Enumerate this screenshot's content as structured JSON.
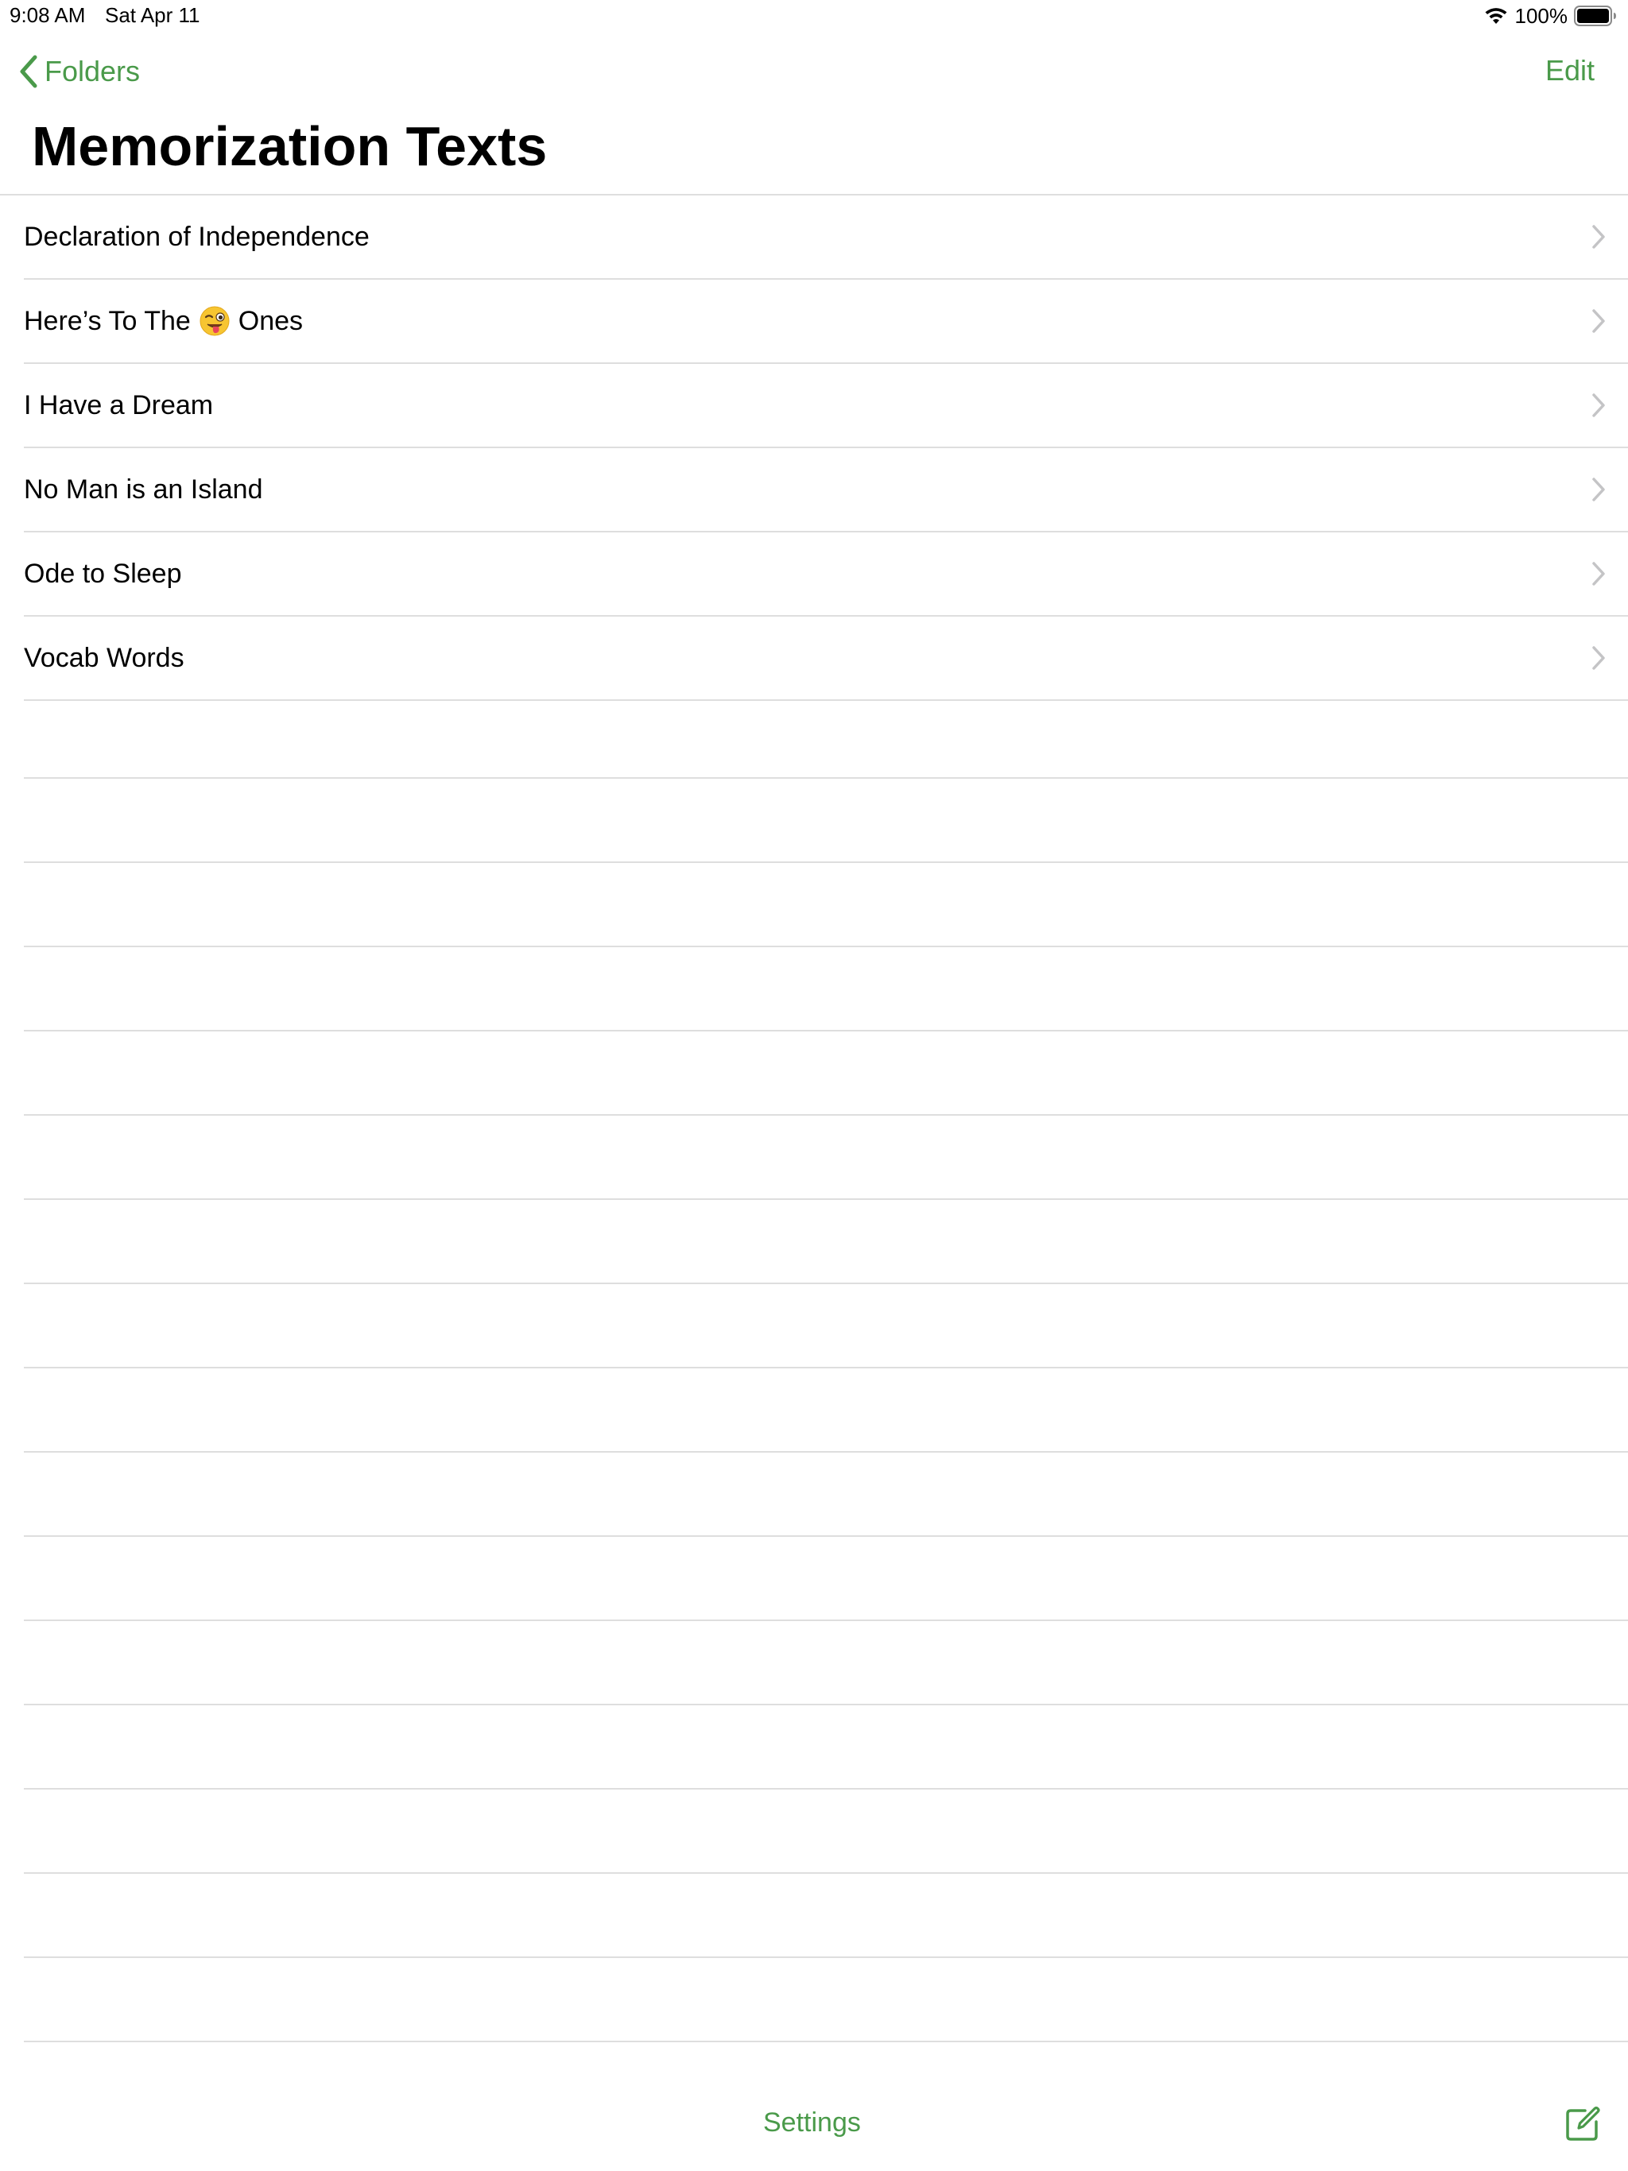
{
  "status_bar": {
    "time": "9:08 AM",
    "date": "Sat Apr 11",
    "battery": "100%"
  },
  "nav": {
    "back_label": "Folders",
    "edit_label": "Edit",
    "title": "Memorization Texts"
  },
  "texts": [
    {
      "label": "Declaration of Independence"
    },
    {
      "label_before": "Here’s To The",
      "emoji": "winking-face-with-tongue-icon",
      "label_after": "Ones"
    },
    {
      "label": "I Have a Dream"
    },
    {
      "label": "No Man is an Island"
    },
    {
      "label": "Ode to Sleep"
    },
    {
      "label": "Vocab Words"
    }
  ],
  "toolbar": {
    "settings_label": "Settings",
    "compose_icon": "compose-icon"
  },
  "colors": {
    "accent": "#4a9a4a",
    "separator": "#dedede",
    "chevron": "#c4c4c6"
  }
}
